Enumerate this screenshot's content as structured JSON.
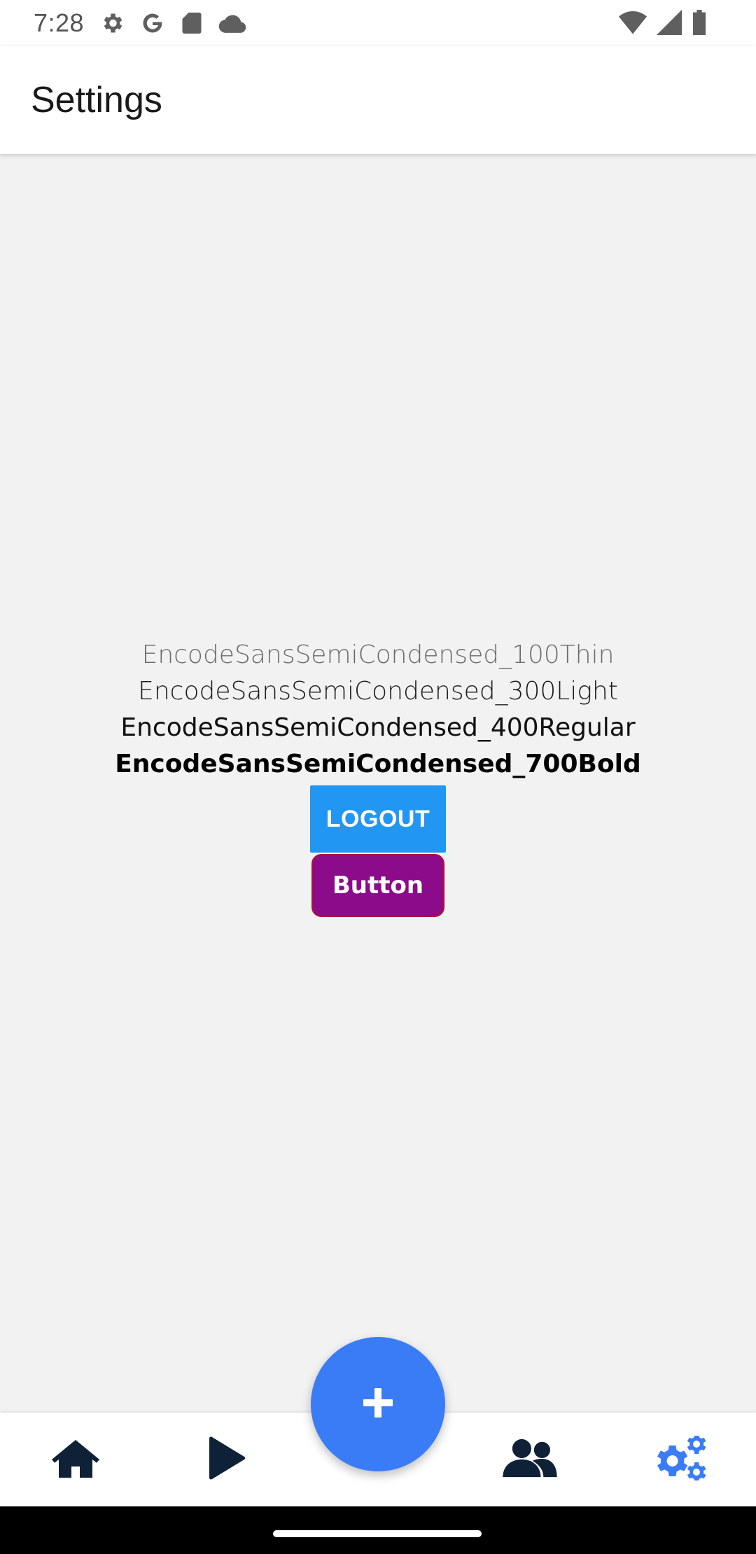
{
  "status_bar": {
    "time": "7:28",
    "left_icons": [
      "settings-gear-icon",
      "google-icon",
      "sd-card-icon",
      "cloud-icon"
    ],
    "right_icons": [
      "wifi-icon",
      "cellular-signal-icon",
      "battery-icon"
    ]
  },
  "app_bar": {
    "title": "Settings"
  },
  "content": {
    "font_samples": [
      "EncodeSansSemiCondensed_100Thin",
      "EncodeSansSemiCondensed_300Light",
      "EncodeSansSemiCondensed_400Regular",
      "EncodeSansSemiCondensed_700Bold"
    ],
    "logout_label": "LOGOUT",
    "button_label": "Button"
  },
  "bottom_nav": {
    "items": [
      {
        "icon": "home-icon",
        "active": false
      },
      {
        "icon": "play-icon",
        "active": false
      },
      {
        "icon": "people-icon",
        "active": false
      },
      {
        "icon": "settings-gears-icon",
        "active": true
      }
    ],
    "fab_icon": "plus-icon"
  },
  "colors": {
    "background": "#f2f2f2",
    "logout_button": "#2196f3",
    "purple_button": "#8b0b8b",
    "fab": "#3a7cf5",
    "nav_icon": "#0f2137",
    "nav_active": "#3a7cf5"
  }
}
